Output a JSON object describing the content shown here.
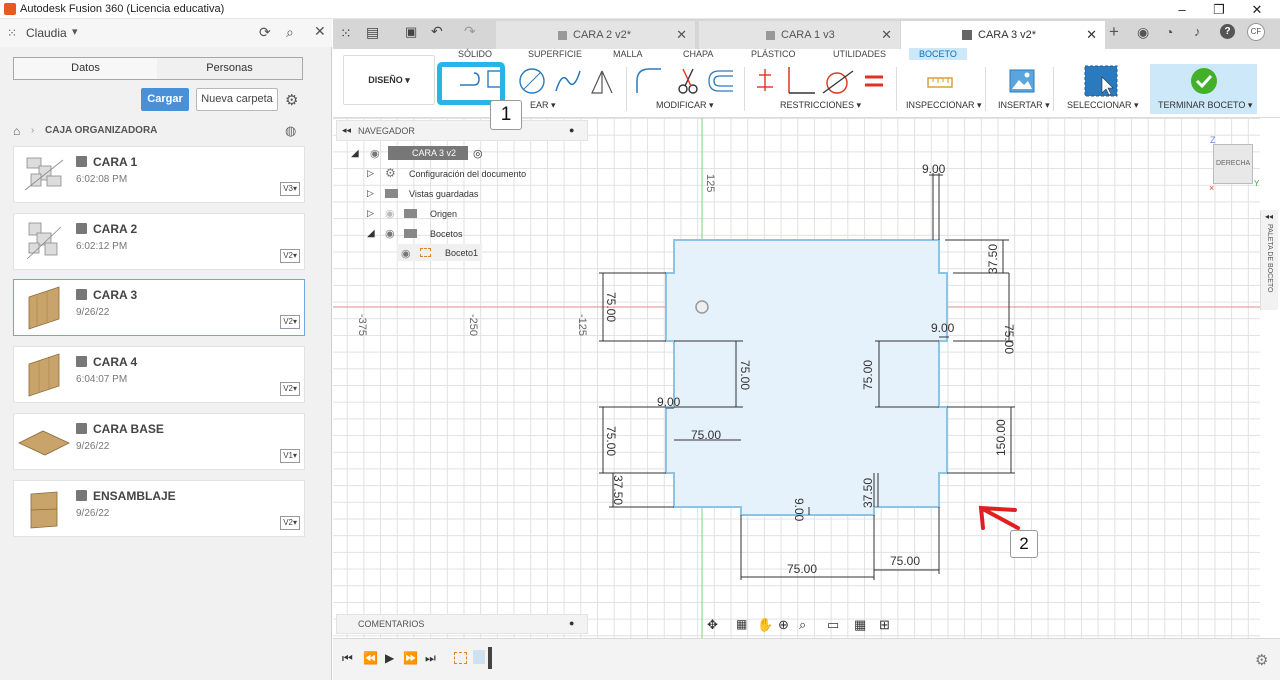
{
  "window": {
    "title": "Autodesk Fusion 360 (Licencia educativa)"
  },
  "data_panel": {
    "user": "Claudia",
    "tabs": [
      "Datos",
      "Personas"
    ],
    "upload_label": "Cargar",
    "new_folder_label": "Nueva carpeta",
    "breadcrumb": "CAJA ORGANIZADORA",
    "items": [
      {
        "name": "CARA 1",
        "date": "6:02:08 PM",
        "version": "V3▾"
      },
      {
        "name": "CARA 2",
        "date": "6:02:12 PM",
        "version": "V2▾"
      },
      {
        "name": "CARA 3",
        "date": "9/26/22",
        "version": "V2▾"
      },
      {
        "name": "CARA 4",
        "date": "6:04:07 PM",
        "version": "V2▾"
      },
      {
        "name": "CARA BASE",
        "date": "9/26/22",
        "version": "V1▾"
      },
      {
        "name": "ENSAMBLAJE",
        "date": "9/26/22",
        "version": "V2▾"
      }
    ]
  },
  "doc_tabs": [
    {
      "label": "CARA 2 v2*"
    },
    {
      "label": "CARA 1 v3"
    },
    {
      "label": "CARA 3 v2*"
    }
  ],
  "ribbon": {
    "workspace": "DISEÑO ▾",
    "tabs": [
      "SÓLIDO",
      "SUPERFICIE",
      "MALLA",
      "CHAPA",
      "PLÁSTICO",
      "UTILIDADES",
      "BOCETO"
    ],
    "groups": {
      "create": "EAR ▾",
      "modify": "MODIFICAR ▾",
      "constraints": "RESTRICCIONES ▾",
      "inspect": "INSPECCIONAR ▾",
      "insert": "INSERTAR ▾",
      "select": "SELECCIONAR ▾",
      "finish": "TERMINAR BOCETO ▾"
    }
  },
  "browser": {
    "title": "NAVEGADOR",
    "root": "CARA 3 v2",
    "nodes": [
      "Configuración del documento",
      "Vistas guardadas",
      "Origen",
      "Bocetos",
      "Boceto1"
    ],
    "comments": "COMENTARIOS"
  },
  "canvas": {
    "axis_labels": [
      "-375",
      "-250",
      "-125",
      "125"
    ],
    "dims": [
      "9.00",
      "37.50",
      "75.00",
      "9.00",
      "75.00",
      "75.00",
      "75.00",
      "9.00",
      "75.00",
      "75.00",
      "37.50",
      "37.50",
      "9.00",
      "150.00",
      "75.00"
    ],
    "viewcube_label": "DERECHA",
    "palette_label": "PALETA DE BOCETO"
  },
  "annotations": {
    "callout1": "1",
    "callout2": "2"
  },
  "colors": {
    "accent": "#0696d7",
    "sketch_fill": "#e5f1fb",
    "sketch_line": "#8cc4e6",
    "callout_blue": "#27b5e6",
    "callout_red": "#e02020",
    "finish_bg": "#cde8f8"
  }
}
